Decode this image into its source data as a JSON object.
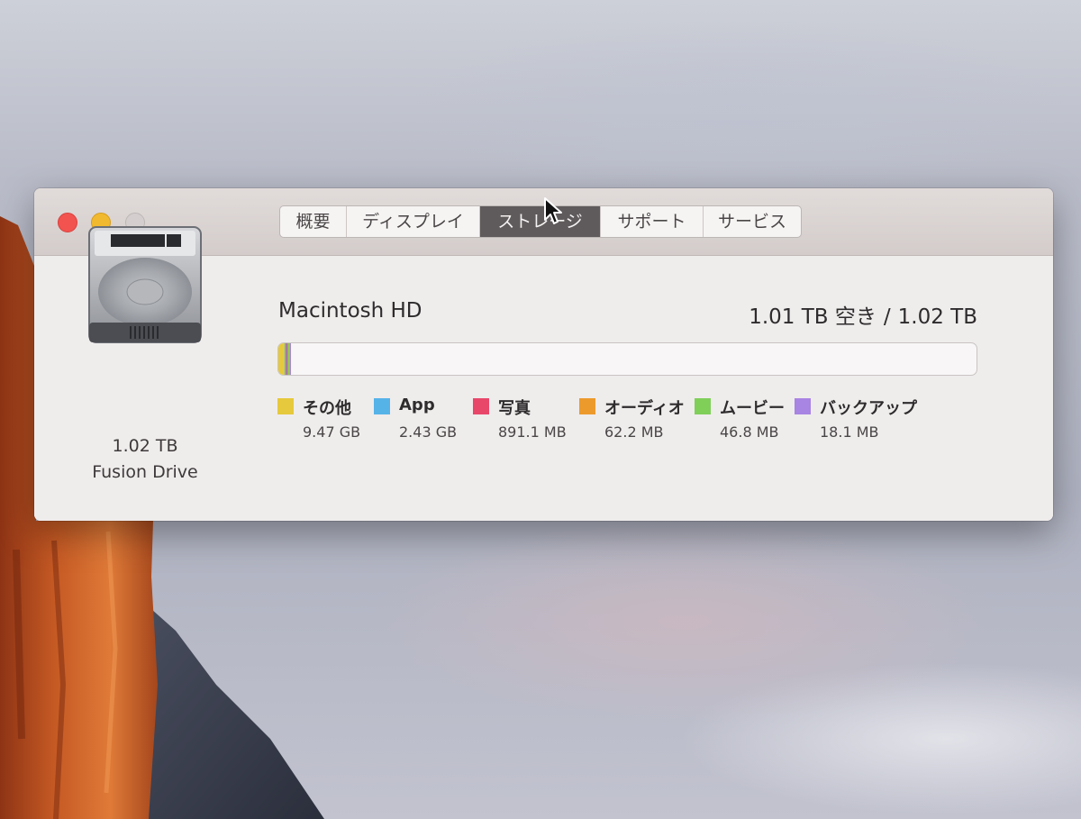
{
  "window": {
    "tabs": [
      {
        "label": "概要",
        "active": false
      },
      {
        "label": "ディスプレイ",
        "active": false
      },
      {
        "label": "ストレージ",
        "active": true
      },
      {
        "label": "サポート",
        "active": false
      },
      {
        "label": "サービス",
        "active": false
      }
    ]
  },
  "disk": {
    "size": "1.02 TB",
    "label": "Fusion Drive"
  },
  "volume": {
    "name": "Macintosh HD",
    "free": "1.01 TB 空き",
    "separator": "/",
    "total": "1.02 TB"
  },
  "usage": {
    "segments": [
      {
        "name": "その他",
        "value": "9.47 GB",
        "color": "#e6c93c",
        "fraction": 0.0093
      },
      {
        "name": "App",
        "value": "2.43 GB",
        "color": "#55b3e8",
        "fraction": 0.0024
      },
      {
        "name": "写真",
        "value": "891.1 MB",
        "color": "#e8476a",
        "fraction": 0.0009
      },
      {
        "name": "オーディオ",
        "value": "62.2 MB",
        "color": "#ec9a2c",
        "fraction": 0.0001
      },
      {
        "name": "ムービー",
        "value": "46.8 MB",
        "color": "#7fcf59",
        "fraction": 0.0001
      },
      {
        "name": "バックアップ",
        "value": "18.1 MB",
        "color": "#a884e3",
        "fraction": 2e-05
      }
    ]
  }
}
